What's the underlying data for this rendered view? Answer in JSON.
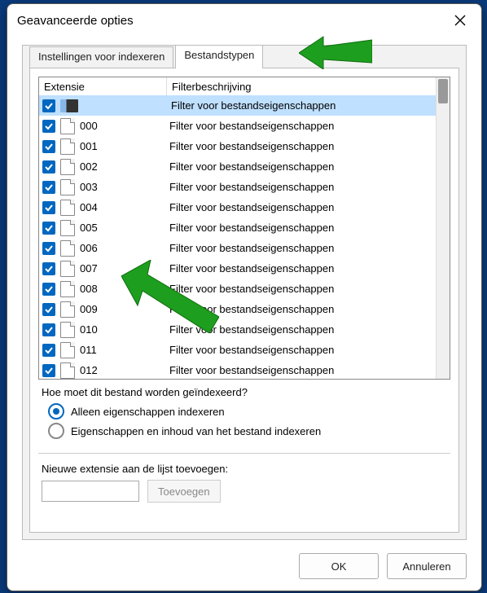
{
  "window": {
    "title": "Geavanceerde opties"
  },
  "tabs": {
    "indexing": "Instellingen voor indexeren",
    "filetypes": "Bestandstypen"
  },
  "list": {
    "header_ext": "Extensie",
    "header_desc": "Filterbeschrijving",
    "rows": [
      {
        "ext": "",
        "desc": "Filter voor bestandseigenschappen",
        "selected": true,
        "sys": true
      },
      {
        "ext": "000",
        "desc": "Filter voor bestandseigenschappen"
      },
      {
        "ext": "001",
        "desc": "Filter voor bestandseigenschappen"
      },
      {
        "ext": "002",
        "desc": "Filter voor bestandseigenschappen"
      },
      {
        "ext": "003",
        "desc": "Filter voor bestandseigenschappen"
      },
      {
        "ext": "004",
        "desc": "Filter voor bestandseigenschappen"
      },
      {
        "ext": "005",
        "desc": "Filter voor bestandseigenschappen"
      },
      {
        "ext": "006",
        "desc": "Filter voor bestandseigenschappen"
      },
      {
        "ext": "007",
        "desc": "Filter voor bestandseigenschappen"
      },
      {
        "ext": "008",
        "desc": "Filter voor bestandseigenschappen"
      },
      {
        "ext": "009",
        "desc": "Filter voor bestandseigenschappen"
      },
      {
        "ext": "010",
        "desc": "Filter voor bestandseigenschappen"
      },
      {
        "ext": "011",
        "desc": "Filter voor bestandseigenschappen"
      },
      {
        "ext": "012",
        "desc": "Filter voor bestandseigenschappen"
      }
    ]
  },
  "indexing": {
    "question": "Hoe moet dit bestand worden geïndexeerd?",
    "option_props": "Alleen eigenschappen indexeren",
    "option_content": "Eigenschappen en inhoud van het bestand indexeren",
    "selected": "props"
  },
  "add": {
    "label": "Nieuwe extensie aan de lijst toevoegen:",
    "value": "",
    "button": "Toevoegen"
  },
  "buttons": {
    "ok": "OK",
    "cancel": "Annuleren"
  },
  "annotations": {
    "arrow1_target": "tab-filetypes",
    "arrow2_target": "list-row-006"
  }
}
